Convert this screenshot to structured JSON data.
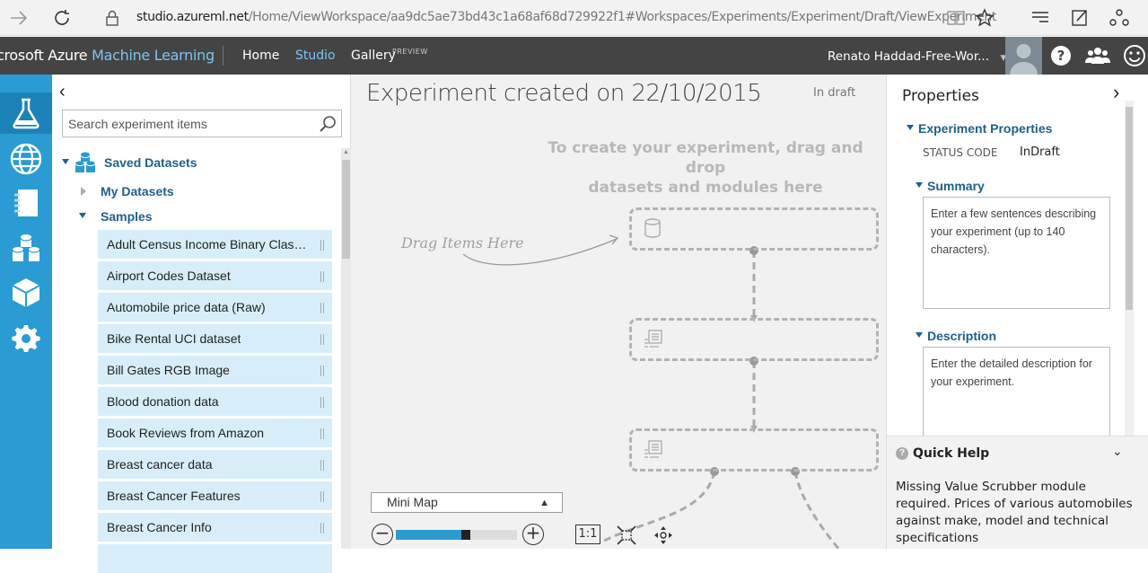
{
  "browser": {
    "url_host": "studio.azureml.net",
    "url_path": "/Home/ViewWorkspace/aa9dc5ae73bd43c1a68af68d729922f1#Workspaces/Experiments/Experiment/Draft/ViewExperiment"
  },
  "topnav": {
    "brand_prefix": "crosoft Azure ",
    "brand_suffix": "Machine Learning",
    "links": [
      "Home",
      "Studio",
      "Gallery"
    ],
    "gallery_badge": "PREVIEW",
    "user": "Renato Haddad-Free-Wor..."
  },
  "leftbar": {
    "items": [
      "experiments-icon",
      "web-services-icon",
      "notebooks-icon",
      "datasets-icon",
      "trained-models-icon",
      "settings-icon"
    ]
  },
  "palette": {
    "search_placeholder": "Search experiment items",
    "saved_datasets": "Saved Datasets",
    "my_datasets": "My Datasets",
    "samples": "Samples",
    "datasets": [
      "Adult Census Income Binary Classification dataset",
      "Airport Codes Dataset",
      "Automobile price data (Raw)",
      "Bike Rental UCI dataset",
      "Bill Gates RGB Image",
      "Blood donation data",
      "Book Reviews from Amazon",
      "Breast cancer data",
      "Breast Cancer Features",
      "Breast Cancer Info"
    ]
  },
  "canvas": {
    "title": "Experiment created on 22/10/2015",
    "status": "In draft",
    "hint_line1": "To create your experiment, drag and drop",
    "hint_line2": "datasets and modules here",
    "drag_label": "Drag Items Here",
    "minimap_label": "Mini Map",
    "zoom_level": 0.58,
    "one_to_one": "1:1"
  },
  "properties": {
    "title": "Properties",
    "experiment_properties": "Experiment Properties",
    "status_code_label": "STATUS CODE",
    "status_code_value": "InDraft",
    "summary": "Summary",
    "summary_placeholder": "Enter a few sentences describing your experiment (up to 140 characters).",
    "description": "Description",
    "description_placeholder": "Enter the detailed description for your experiment."
  },
  "quick_help": {
    "title": "Quick Help",
    "text": "Missing Value Scrubber module required. Prices of various automobiles against make, model and technical specifications"
  },
  "colors": {
    "accent": "#2a9bd3",
    "nav_bg": "#444444",
    "link": "#1e5f8c",
    "dataset_bg": "#d7eefa"
  }
}
